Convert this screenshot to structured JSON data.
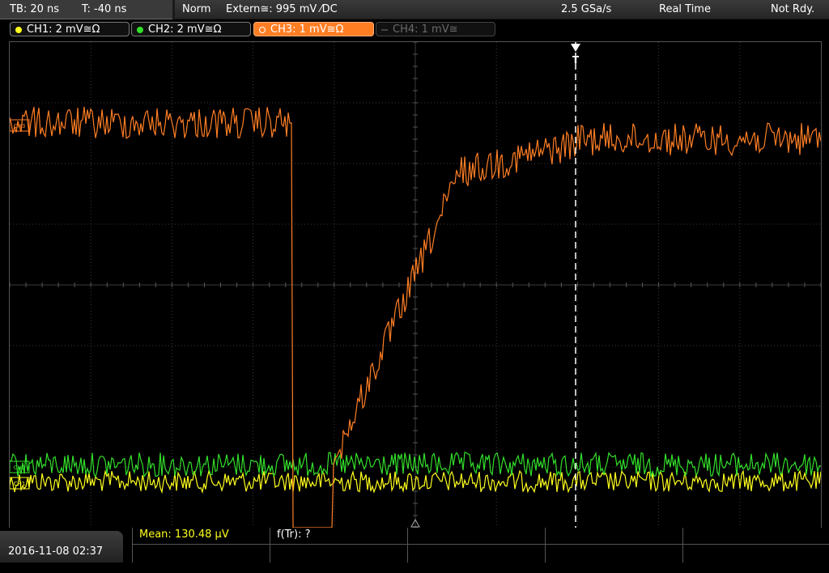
{
  "status": {
    "timebase": "TB: 20 ns",
    "trigger_offset": "T: -40 ns",
    "trigger_mode": "Norm",
    "trigger_source": "Extern≅: 995 mV ⁄DC",
    "sample_rate": "2.5 GSa/s",
    "acq_mode": "Real Time",
    "state": "Not Rdy."
  },
  "channels": [
    {
      "label": "CH1: 2 mV≅Ω",
      "color": "#ffff1e",
      "state": "on"
    },
    {
      "label": "CH2: 2 mV≅Ω",
      "color": "#33e02b",
      "state": "on"
    },
    {
      "label": "CH3: 1 mV≅Ω",
      "color": "#ff7e24",
      "state": "active"
    },
    {
      "label": "CH4: 1 mV≅",
      "color": "#555555",
      "state": "off"
    }
  ],
  "markers": {
    "trigger": "T",
    "ch1": "CH1",
    "ch2": "CH2",
    "ch3": "CH3"
  },
  "bottom": {
    "datetime": "2016-11-08 02:37",
    "measurements": [
      {
        "text": "Mean: 130.48 µV",
        "color": "#ffff1e"
      },
      {
        "text": "f(Tr): ?",
        "color": "#ffffff"
      }
    ]
  },
  "colors": {
    "grid": "#3c3c3c",
    "trigger_line": "#ffffff"
  }
}
